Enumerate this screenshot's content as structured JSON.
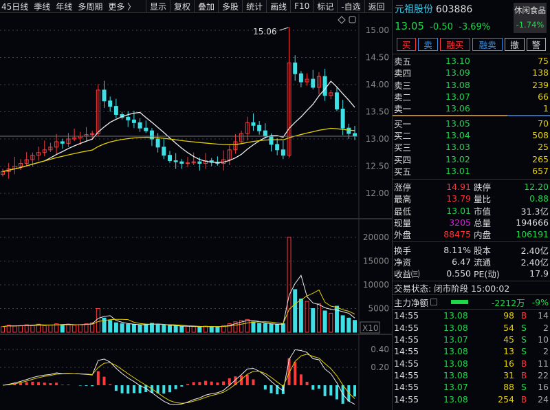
{
  "toolbar": {
    "periods": [
      "45日线",
      "季线",
      "年线",
      "多周期",
      "更多 〉"
    ],
    "buttons": [
      "显示",
      "复权",
      "叠加",
      "多股",
      "统计",
      "画线",
      "F10",
      "标记",
      "-自选",
      "返回"
    ]
  },
  "chart": {
    "high_label": "15.06",
    "price_ticks": [
      "15.00",
      "14.50",
      "14.00",
      "13.50",
      "13.00",
      "12.50",
      "12.00"
    ],
    "vol_ticks": [
      "20000",
      "15000",
      "10000",
      "5000"
    ],
    "vol_multiplier": "X10",
    "ind_ticks": [
      "0.40",
      "0.20"
    ]
  },
  "chart_data": {
    "type": "candlestick",
    "ylim": [
      11.75,
      15.3
    ],
    "closes": [
      12.4,
      12.45,
      12.5,
      12.55,
      12.62,
      12.7,
      12.75,
      12.8,
      12.85,
      12.95,
      12.92,
      13.0,
      13.02,
      13.05,
      13.08,
      13.1,
      13.9,
      13.7,
      13.6,
      13.45,
      13.4,
      13.35,
      13.3,
      13.2,
      13.15,
      13.0,
      12.85,
      12.7,
      12.6,
      12.58,
      12.55,
      12.56,
      12.58,
      12.55,
      12.6,
      12.57,
      12.55,
      12.62,
      12.8,
      12.95,
      13.1,
      13.3,
      13.25,
      13.15,
      13.05,
      12.9,
      12.8,
      12.7,
      14.4,
      14.2,
      14.05,
      14.1,
      13.95,
      14.15,
      13.8,
      13.85,
      13.55,
      13.2,
      13.1,
      13.05
    ],
    "volumes": [
      1200,
      1500,
      1300,
      1400,
      1600,
      1500,
      1700,
      1400,
      1500,
      1800,
      1600,
      1700,
      1500,
      1600,
      1800,
      2000,
      5000,
      3000,
      2500,
      2000,
      1800,
      1700,
      1600,
      1500,
      1700,
      1900,
      1600,
      1500,
      1400,
      1300,
      1200,
      1300,
      1200,
      1100,
      1300,
      1200,
      1100,
      1400,
      1800,
      2200,
      2500,
      2700,
      2200,
      1900,
      1800,
      1700,
      1600,
      1800,
      20000,
      9000,
      7000,
      6500,
      5000,
      6000,
      4500,
      4000,
      5500,
      3500,
      3000,
      2500
    ]
  },
  "stock": {
    "name": "元祖股份",
    "code": "603886",
    "price": "13.05",
    "change": "-0.50",
    "pct": "-3.69%",
    "sector": "休闲食品",
    "sector_pct": "-1.74%"
  },
  "trade_buttons": [
    "买",
    "卖",
    "融买",
    "融卖",
    "撤",
    "警"
  ],
  "asks": [
    {
      "l": "卖五",
      "p": "13.10",
      "v": "75"
    },
    {
      "l": "卖四",
      "p": "13.09",
      "v": "138"
    },
    {
      "l": "卖三",
      "p": "13.08",
      "v": "239"
    },
    {
      "l": "卖二",
      "p": "13.07",
      "v": "66"
    },
    {
      "l": "卖一",
      "p": "13.06",
      "v": "1"
    }
  ],
  "bids": [
    {
      "l": "买一",
      "p": "13.05",
      "v": "70"
    },
    {
      "l": "买二",
      "p": "13.04",
      "v": "508"
    },
    {
      "l": "买三",
      "p": "13.03",
      "v": "25"
    },
    {
      "l": "买四",
      "p": "13.02",
      "v": "265"
    },
    {
      "l": "买五",
      "p": "13.01",
      "v": "657"
    }
  ],
  "stats": [
    {
      "a": "涨停",
      "av": "14.91",
      "ac": "r",
      "b": "跌停",
      "bv": "12.20",
      "bc": "g"
    },
    {
      "a": "最高",
      "av": "13.79",
      "ac": "r",
      "b": "量比",
      "bv": "0.88",
      "bc": "g"
    },
    {
      "a": "最低",
      "av": "13.01",
      "ac": "g",
      "b": "市值",
      "bv": "31.3亿",
      "bc": "w"
    },
    {
      "a": "现量",
      "av": "3205",
      "ac": "m",
      "b": "总量",
      "bv": "194666",
      "bc": "w"
    },
    {
      "a": "外盘",
      "av": "88475",
      "ac": "r",
      "b": "内盘",
      "bv": "106191",
      "bc": "g"
    }
  ],
  "stats2": [
    {
      "a": "换手",
      "av": "8.11%",
      "b": "股本",
      "bv": "2.40亿"
    },
    {
      "a": "净资",
      "av": "6.47",
      "b": "流通",
      "bv": "2.40亿"
    },
    {
      "a": "收益㈢",
      "av": "0.550",
      "b": "PE(动)",
      "bv": "17.9"
    }
  ],
  "status": "交易状态: 闭市阶段 15:00:02",
  "flow": {
    "label": "主力净额",
    "value": "-2212万",
    "pct": "-9%"
  },
  "ticks": [
    {
      "t": "14:55",
      "p": "13.08",
      "v": "98",
      "d": "B",
      "n": "14"
    },
    {
      "t": "14:55",
      "p": "13.08",
      "v": "54",
      "d": "S",
      "n": "2"
    },
    {
      "t": "14:55",
      "p": "13.07",
      "v": "45",
      "d": "S",
      "n": "10"
    },
    {
      "t": "14:55",
      "p": "13.08",
      "v": "13",
      "d": "S",
      "n": "2"
    },
    {
      "t": "14:55",
      "p": "13.08",
      "v": "16",
      "d": "B",
      "n": "11"
    },
    {
      "t": "14:55",
      "p": "13.08",
      "v": "31",
      "d": "B",
      "n": "22"
    },
    {
      "t": "14:55",
      "p": "13.07",
      "v": "88",
      "d": "S",
      "n": "16"
    },
    {
      "t": "14:55",
      "p": "13.08",
      "v": "254",
      "d": "B",
      "n": "24"
    }
  ]
}
